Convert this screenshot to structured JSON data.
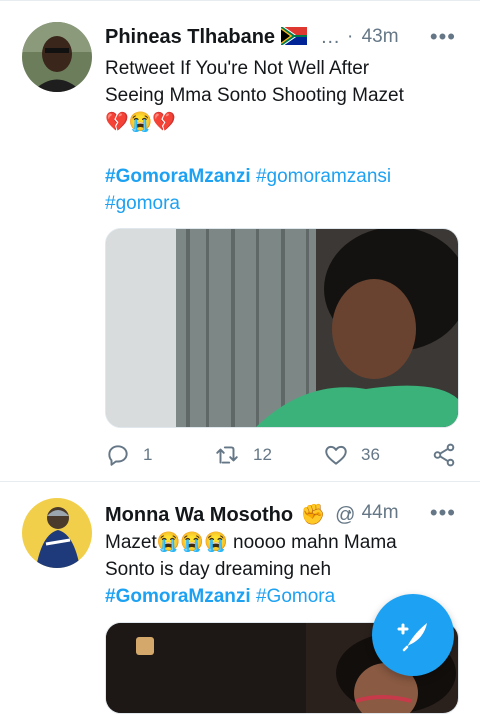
{
  "tweets": [
    {
      "author": "Phineas Tlhabane",
      "author_suffix": "…",
      "time_sep": "·",
      "time": "43m",
      "more": "•••",
      "text_line1": "Retweet If You're Not Well After",
      "text_line2": "Seeing Mma Sonto Shooting Mazet",
      "emoji_line": "💔😭💔",
      "hashtag1": "#GomoraMzanzi",
      "hashtag2": "#gomoramzansi",
      "hashtag3": "#gomora",
      "replies": "1",
      "retweets": "12",
      "likes": "36"
    },
    {
      "author": "Monna Wa Mosotho",
      "author_emoji": "✊",
      "handle_fragment": "@",
      "time_sep": "·",
      "time": "44m",
      "more": "•••",
      "text_start": "Mazet",
      "text_emojis": "😭😭😭",
      "text_rest": " noooo mahn Mama",
      "text_line2": "Sonto is day dreaming neh",
      "hashtag1": "#GomoraMzanzi",
      "hashtag2": "#Gomora"
    }
  ],
  "icons": {
    "reply": "reply-icon",
    "retweet": "retweet-icon",
    "like": "heart-icon",
    "share": "share-icon",
    "compose": "compose-tweet-icon"
  },
  "colors": {
    "accent": "#1da1f2",
    "muted": "#657786",
    "text": "#14171a"
  }
}
